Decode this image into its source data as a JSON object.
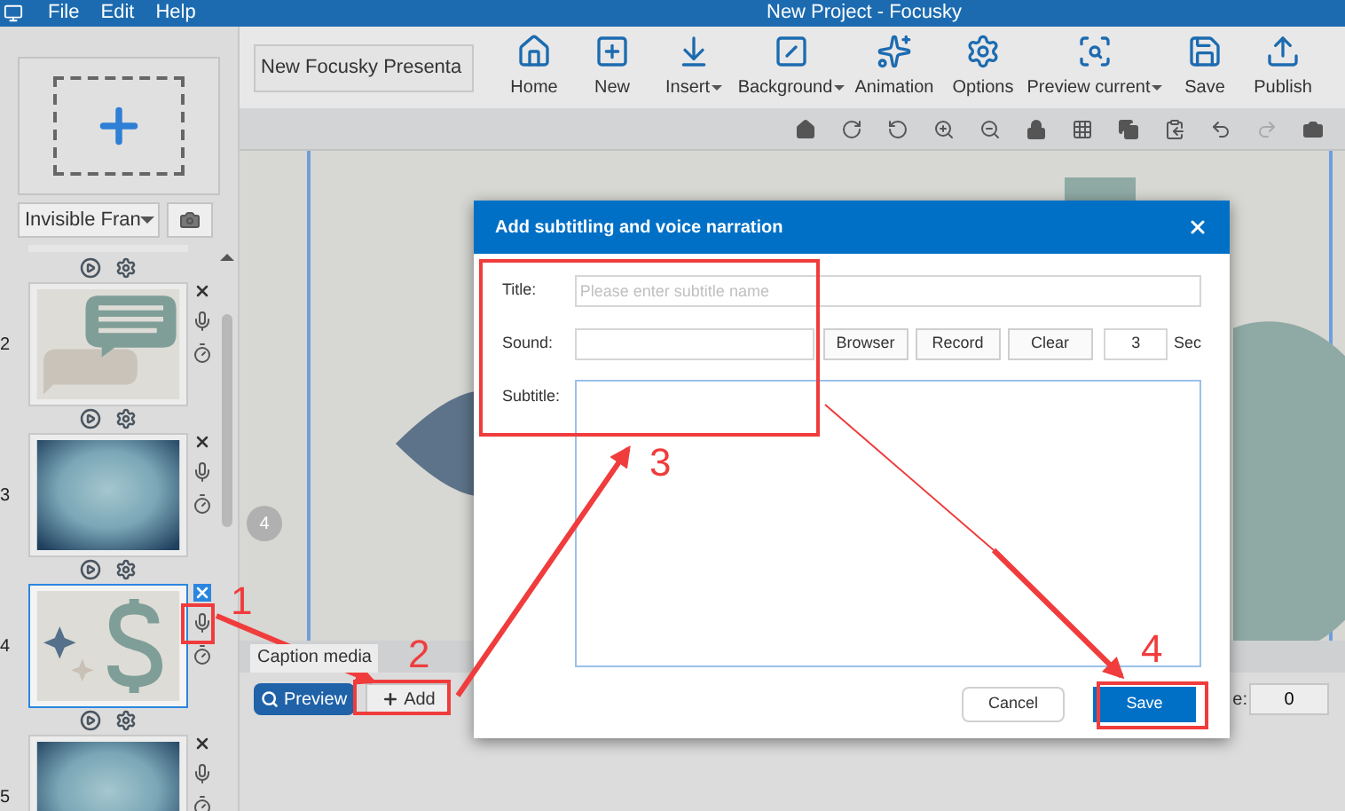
{
  "window": {
    "title": "New Project - Focusky"
  },
  "menu": [
    "File",
    "Edit",
    "Help"
  ],
  "sidebar": {
    "frame_type": "Invisible Fran",
    "slides": [
      {
        "number": "2",
        "kind": "speech",
        "selected": false
      },
      {
        "number": "3",
        "kind": "gradient",
        "selected": false
      },
      {
        "number": "4",
        "kind": "dollar",
        "selected": true
      },
      {
        "number": "5",
        "kind": "gradient",
        "selected": false
      }
    ]
  },
  "project_name": "New Focusky Presenta",
  "toolbar": [
    {
      "label": "Home",
      "dropdown": false
    },
    {
      "label": "New",
      "dropdown": false
    },
    {
      "label": "Insert",
      "dropdown": true
    },
    {
      "label": "Background",
      "dropdown": true
    },
    {
      "label": "Animation",
      "dropdown": false
    },
    {
      "label": "Options",
      "dropdown": false
    },
    {
      "label": "Preview current",
      "dropdown": true
    },
    {
      "label": "Save",
      "dropdown": false
    },
    {
      "label": "Publish",
      "dropdown": false
    }
  ],
  "canvas": {
    "frame_badge": "4"
  },
  "caption_panel": {
    "tab": "Caption media",
    "preview_button": "Preview",
    "add_button": "Add",
    "field_label": "e:",
    "field_value": "0"
  },
  "dialog": {
    "title": "Add subtitling and voice narration",
    "title_label": "Title:",
    "title_placeholder": "Please enter subtitle name",
    "sound_label": "Sound:",
    "sound_buttons": [
      "Browser",
      "Record",
      "Clear"
    ],
    "duration": "3",
    "duration_unit": "Sec",
    "subtitle_label": "Subtitle:",
    "cancel": "Cancel",
    "save": "Save"
  },
  "annotations": [
    "1",
    "2",
    "3",
    "4"
  ]
}
